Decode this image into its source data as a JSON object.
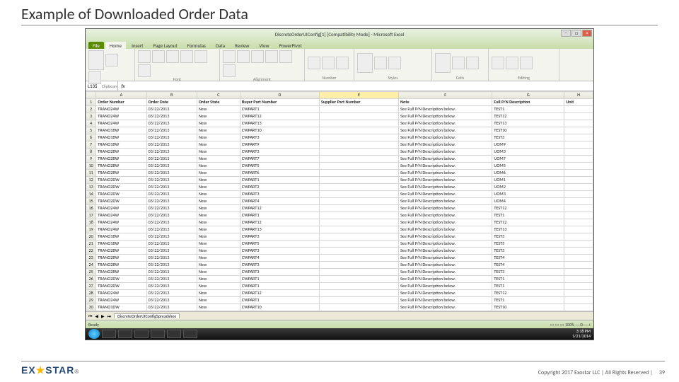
{
  "slide": {
    "title": "Example of Downloaded Order Data",
    "copyright": "Copyright 2017 Exostar LLC | All Rights Reserved |",
    "page": "39",
    "logo_a": "EX",
    "logo_b": "★",
    "logo_c": "STAR",
    "logo_r": "®"
  },
  "excel": {
    "title": "DiscreteOrderUIConfig[1] [Compatibility Mode] - Microsoft Excel",
    "tabs": [
      "File",
      "Home",
      "Insert",
      "Page Layout",
      "Formulas",
      "Data",
      "Review",
      "View",
      "PowerPivot"
    ],
    "groups": [
      "Clipboard",
      "Font",
      "Alignment",
      "Number",
      "Styles",
      "Cells",
      "Editing"
    ],
    "namebox": "L135",
    "sheettab": "DiscreteOrderUIConfigSpreadshee",
    "status": "Ready",
    "taskbar_time": "3:18 PM",
    "taskbar_date": "1/21/2014",
    "cols": [
      "",
      "A",
      "B",
      "C",
      "D",
      "E",
      "F",
      "G",
      "H"
    ],
    "headers": [
      "Order Number",
      "Order Date",
      "Order State",
      "Buyer Part Number",
      "Supplier Part Number",
      "Note",
      "Full P/N Description",
      "Unit"
    ],
    "rows": [
      [
        "2",
        "TRANO24W",
        "03/22/2013",
        "New",
        "CWPART1",
        "",
        "See Full P/N Description below.",
        "TEST1",
        ""
      ],
      [
        "3",
        "TRANO24W",
        "03/22/2013",
        "New",
        "CWPART12",
        "",
        "See Full P/N Description below.",
        "TEST12",
        ""
      ],
      [
        "4",
        "TRANO24W",
        "03/22/2013",
        "New",
        "CWPART13",
        "",
        "See Full P/N Description below.",
        "TEST13",
        ""
      ],
      [
        "5",
        "TRANO1BW",
        "03/22/2013",
        "New",
        "CWPART10",
        "",
        "See Full P/N Description below.",
        "TEST10",
        ""
      ],
      [
        "6",
        "TRANO1BW",
        "03/22/2013",
        "New",
        "CWPART3",
        "",
        "See Full P/N Description below.",
        "TEST3",
        ""
      ],
      [
        "7",
        "TRANO1BW",
        "03/22/2013",
        "New",
        "CWPART9",
        "",
        "See Full P/N Description below.",
        "UOM9",
        ""
      ],
      [
        "8",
        "TRANO2BW",
        "03/22/2013",
        "New",
        "CWPART3",
        "",
        "See Full P/N Description below.",
        "UOM3",
        ""
      ],
      [
        "9",
        "TRANO2BW",
        "03/22/2013",
        "New",
        "CWPART7",
        "",
        "See Full P/N Description below.",
        "UOM7",
        ""
      ],
      [
        "10",
        "TRANO2BW",
        "03/22/2013",
        "New",
        "CWPART5",
        "",
        "See Full P/N Description below.",
        "UOM5",
        ""
      ],
      [
        "11",
        "TRANO2BW",
        "03/22/2013",
        "New",
        "CWPART6",
        "",
        "See Full P/N Description below.",
        "UOM6",
        ""
      ],
      [
        "12",
        "TRANO2DW",
        "03/22/2013",
        "New",
        "CWPART1",
        "",
        "See Full P/N Description below.",
        "UOM1",
        ""
      ],
      [
        "13",
        "TRANO2DW",
        "03/22/2013",
        "New",
        "CWPART2",
        "",
        "See Full P/N Description below.",
        "UOM2",
        ""
      ],
      [
        "14",
        "TRANO2DW",
        "03/22/2013",
        "New",
        "CWPART3",
        "",
        "See Full P/N Description below.",
        "UOM3",
        ""
      ],
      [
        "15",
        "TRANO2DW",
        "03/22/2013",
        "New",
        "CWPART4",
        "",
        "See Full P/N Description below.",
        "UOM4",
        ""
      ],
      [
        "16",
        "TRANO24W",
        "03/22/2013",
        "New",
        "CWPART12",
        "",
        "See Full P/N Description below.",
        "TEST12",
        ""
      ],
      [
        "17",
        "TRANO24W",
        "03/22/2013",
        "New",
        "CWPART1",
        "",
        "See Full P/N Description below.",
        "TEST1",
        ""
      ],
      [
        "18",
        "TRANO24W",
        "03/22/2013",
        "New",
        "CWPART12",
        "",
        "See Full P/N Description below.",
        "TEST12",
        ""
      ],
      [
        "19",
        "TRANO24W",
        "03/22/2013",
        "New",
        "CWPART13",
        "",
        "See Full P/N Description below.",
        "TEST13",
        ""
      ],
      [
        "20",
        "TRANO1BW",
        "03/22/2013",
        "New",
        "CWPART3",
        "",
        "See Full P/N Description below.",
        "TEST3",
        ""
      ],
      [
        "21",
        "TRANO1BW",
        "03/22/2013",
        "New",
        "CWPART5",
        "",
        "See Full P/N Description below.",
        "TEST5",
        ""
      ],
      [
        "22",
        "TRANO2BW",
        "03/22/2013",
        "New",
        "CWPART3",
        "",
        "See Full P/N Description below.",
        "TEST3",
        ""
      ],
      [
        "23",
        "TRANO2BW",
        "03/22/2013",
        "New",
        "CWPART4",
        "",
        "See Full P/N Description below.",
        "TEST4",
        ""
      ],
      [
        "24",
        "TRANO2BW",
        "03/22/2013",
        "New",
        "CWPART3",
        "",
        "See Full P/N Description below.",
        "TEST4",
        ""
      ],
      [
        "25",
        "TRANO2BW",
        "03/22/2013",
        "New",
        "CWPART3",
        "",
        "See Full P/N Description below.",
        "TEST3",
        ""
      ],
      [
        "26",
        "TRANO2DW",
        "03/22/2013",
        "New",
        "CWPART1",
        "",
        "See Full P/N Description below.",
        "TEST1",
        ""
      ],
      [
        "27",
        "TRANO2DW",
        "03/22/2013",
        "New",
        "CWPART1",
        "",
        "See Full P/N Description below.",
        "TEST1",
        ""
      ],
      [
        "28",
        "TRANO24W",
        "03/22/2013",
        "New",
        "CWPART12",
        "",
        "See Full P/N Description below.",
        "TEST12",
        ""
      ],
      [
        "29",
        "TRANO24W",
        "03/22/2013",
        "New",
        "CWPART1",
        "",
        "See Full P/N Description below.",
        "TEST1",
        ""
      ],
      [
        "30",
        "TRANO1DW",
        "03/22/2013",
        "New",
        "CWPART10",
        "",
        "See Full P/N Description below.",
        "TEST10",
        ""
      ]
    ]
  }
}
